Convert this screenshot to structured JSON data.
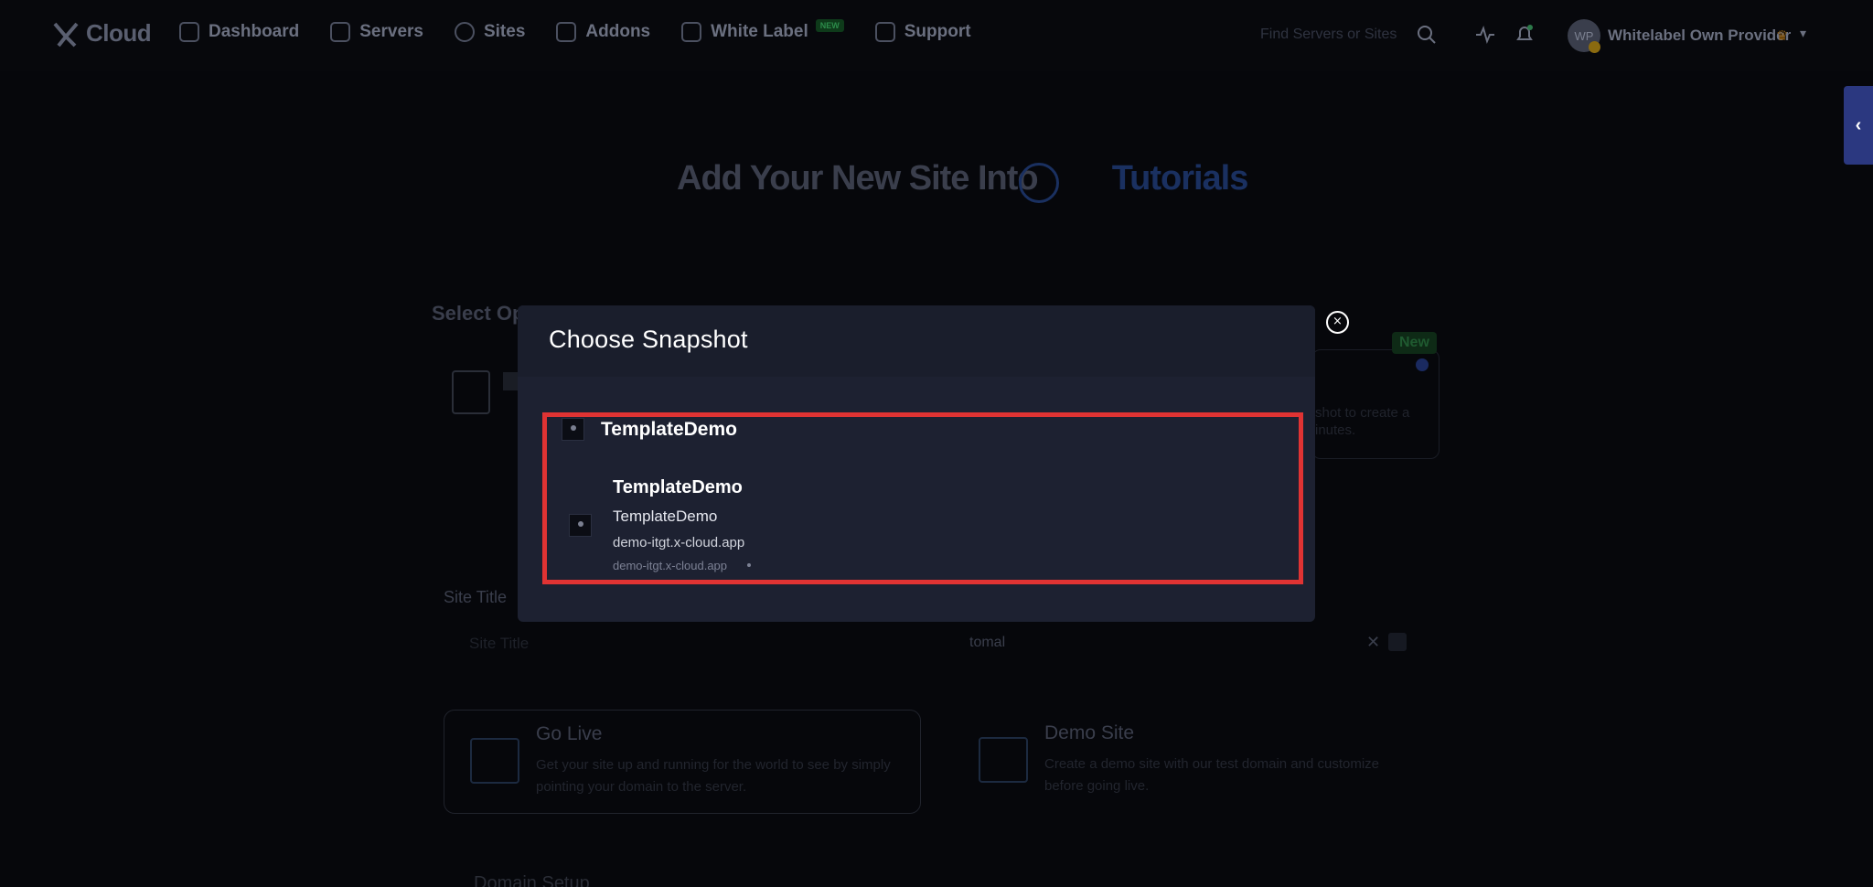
{
  "nav": {
    "logo_text": "Cloud",
    "items": [
      {
        "label": "Dashboard"
      },
      {
        "label": "Servers"
      },
      {
        "label": "Sites"
      },
      {
        "label": "Addons"
      },
      {
        "label": "White Label",
        "badge": "NEW"
      },
      {
        "label": "Support"
      }
    ],
    "search_placeholder": "Find Servers or Sites",
    "avatar_initials": "WP",
    "provider_name": "Whitelabel Own Provider"
  },
  "page": {
    "heading_prefix": "Add Your New Site Into",
    "heading_accent": "Tutorials",
    "select_label": "Select Op",
    "new_badge": "New",
    "right_card_text_1": "shot to create a",
    "right_card_text_2": "inutes.",
    "site_title_label": "Site Title",
    "site_title_placeholder": "Site Title",
    "tag_value": "tomal",
    "go_live_title": "Go Live",
    "go_live_desc": "Get your site up and running for the world to see by simply pointing your domain to the server.",
    "demo_title": "Demo Site",
    "demo_desc": "Create a demo site with our test domain and customize before going live.",
    "domain_setup": "Domain Setup"
  },
  "modal": {
    "title": "Choose Snapshot",
    "close_label": "×",
    "group_label": "TemplateDemo",
    "item": {
      "title": "TemplateDemo",
      "subtitle": "TemplateDemo",
      "domain": "demo-itgt.x-cloud.app",
      "domain_small": "demo-itgt.x-cloud.app"
    }
  },
  "colors": {
    "modal_bg": "#1d2131",
    "highlight": "#e03333",
    "side_toggle": "#2b3880"
  }
}
